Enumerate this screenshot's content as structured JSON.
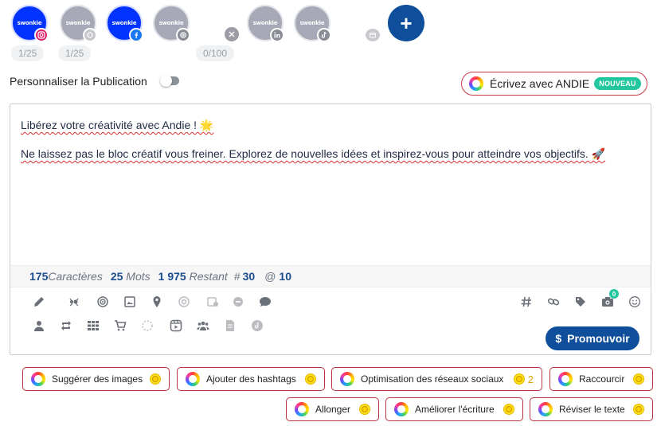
{
  "accounts": [
    {
      "label": "swonkie",
      "network": "instagram-icon",
      "active": true
    },
    {
      "label": "swonkie",
      "network": "threads-light-icon",
      "active": false
    },
    {
      "label": "swonkie",
      "network": "facebook-icon",
      "active": true
    },
    {
      "label": "swonkie",
      "network": "threads-icon",
      "active": false
    },
    {
      "label": "swonkie",
      "network": "linkedin-icon",
      "active": false
    },
    {
      "label": "swonkie",
      "network": "tiktok-icon",
      "active": false
    }
  ],
  "counters": {
    "first": "1/25",
    "second": "1/25",
    "third": "0/100"
  },
  "personalise_label": "Personnaliser la Publication",
  "andie": {
    "label": "Écrivez avec ANDIE",
    "badge": "NOUVEAU"
  },
  "editor": {
    "line1": "Libérez votre créativité avec Andie ! 🌟",
    "line2": "Ne laissez pas le bloc créatif vous freiner. Explorez de nouvelles idées et inspirez-vous pour atteindre vos objectifs. 🚀"
  },
  "stats": {
    "chars_num": "175",
    "chars_label": "Caractères",
    "words_num": "25",
    "words_label": "Mots",
    "remaining_num": "1 975",
    "remaining_label": "Restant",
    "hashtag_symbol": "#",
    "hashtag_num": "30",
    "mention_symbol": "@",
    "mention_num": "10"
  },
  "media_badge": "0",
  "promote_label": "Promouvoir",
  "promote_symbol": "$",
  "ai_actions": [
    {
      "label": "Suggérer des images"
    },
    {
      "label": "Ajouter des hashtags"
    },
    {
      "label": "Optimisation des réseaux sociaux",
      "count": "2"
    },
    {
      "label": "Raccourcir"
    },
    {
      "label": "Allonger"
    },
    {
      "label": "Améliorer l'écriture"
    },
    {
      "label": "Réviser le texte"
    }
  ],
  "colors": {
    "primary": "#0e4e9a",
    "account_active": "#0033ff",
    "accent_red": "#c63845",
    "new_badge": "#22c7a0"
  }
}
